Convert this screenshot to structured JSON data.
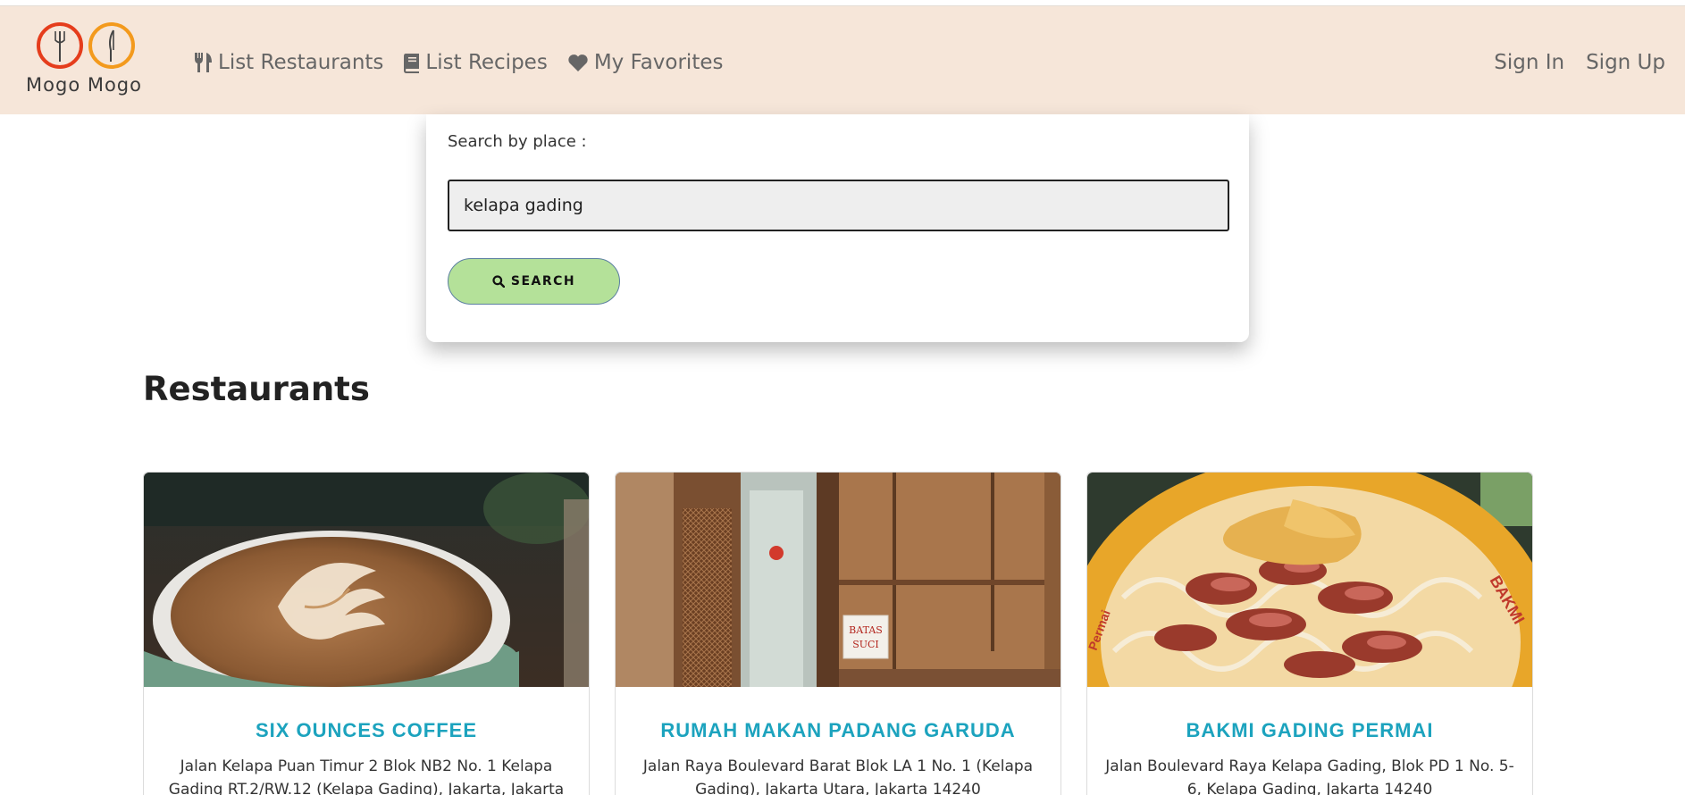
{
  "brand": {
    "name": "Mogo Mogo",
    "icon": "plate-fork-knife-logo"
  },
  "nav": {
    "items": [
      {
        "label": "List Restaurants",
        "icon": "utensils-icon"
      },
      {
        "label": "List Recipes",
        "icon": "book-icon"
      },
      {
        "label": "My Favorites",
        "icon": "heart-icon"
      }
    ],
    "sign_in": "Sign In",
    "sign_up": "Sign Up"
  },
  "search": {
    "label": "Search by place :",
    "value": "kelapa gading",
    "button_label": "SEARCH",
    "button_icon": "search-icon"
  },
  "section_title": "Restaurants",
  "restaurants": [
    {
      "name": "SIX OUNCES COFFEE",
      "address": "Jalan Kelapa Puan Timur 2 Blok NB2 No. 1 Kelapa Gading RT.2/RW.12 (Kelapa Gading), Jakarta, Jakarta",
      "image": "latte-art-coffee-cup"
    },
    {
      "name": "RUMAH MAKAN PADANG GARUDA",
      "address": "Jalan Raya Boulevard Barat Blok LA 1 No. 1 (Kelapa Gading), Jakarta Utara, Jakarta 14240",
      "image": "restaurant-entrance-batas-suci",
      "sign_text": "BATAS SUCI"
    },
    {
      "name": "BAKMI GADING PERMAI",
      "address": "Jalan Boulevard Raya Kelapa Gading, Blok PD 1 No. 5-6, Kelapa Gading, Jakarta 14240",
      "image": "noodle-bowl-with-pork"
    }
  ],
  "colors": {
    "navbar_bg": "#f6e6d9",
    "accent_title": "#1ca3be",
    "search_button": "#b4e199"
  }
}
